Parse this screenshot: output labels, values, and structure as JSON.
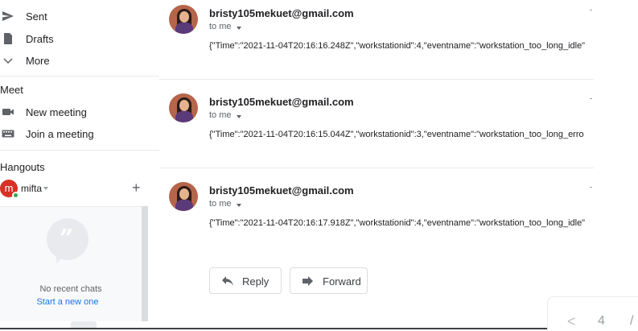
{
  "sidebar": {
    "sent": "Sent",
    "drafts": "Drafts",
    "more": "More",
    "meet_title": "Meet",
    "new_meeting": "New meeting",
    "join_meeting": "Join a meeting",
    "hangouts_title": "Hangouts",
    "hangouts_user": "mifta",
    "avatar_letter": "m",
    "no_recent_chats": "No recent chats",
    "start_new": "Start a new one"
  },
  "messages": [
    {
      "sender": "bristy105mekuet@gmail.com",
      "to": "to me",
      "body": "{\"Time\":\"2021-11-04T20:16:16.248Z\",\"workstationid\":4,\"eventname\":\"workstation_too_long_idle\""
    },
    {
      "sender": "bristy105mekuet@gmail.com",
      "to": "to me",
      "body": "{\"Time\":\"2021-11-04T20:16:15.044Z\",\"workstationid\":3,\"eventname\":\"workstation_too_long_erro"
    },
    {
      "sender": "bristy105mekuet@gmail.com",
      "to": "to me",
      "body": "{\"Time\":\"2021-11-04T20:16:17.918Z\",\"workstationid\":4,\"eventname\":\"workstation_too_long_idle\""
    }
  ],
  "actions": {
    "reply": "Reply",
    "forward": "Forward"
  },
  "pager": {
    "prev": "<",
    "page": "4",
    "separator": "/"
  },
  "colors": {
    "accent_link": "#1a73e8",
    "avatar_red": "#d93025",
    "online_green": "#34a853"
  }
}
